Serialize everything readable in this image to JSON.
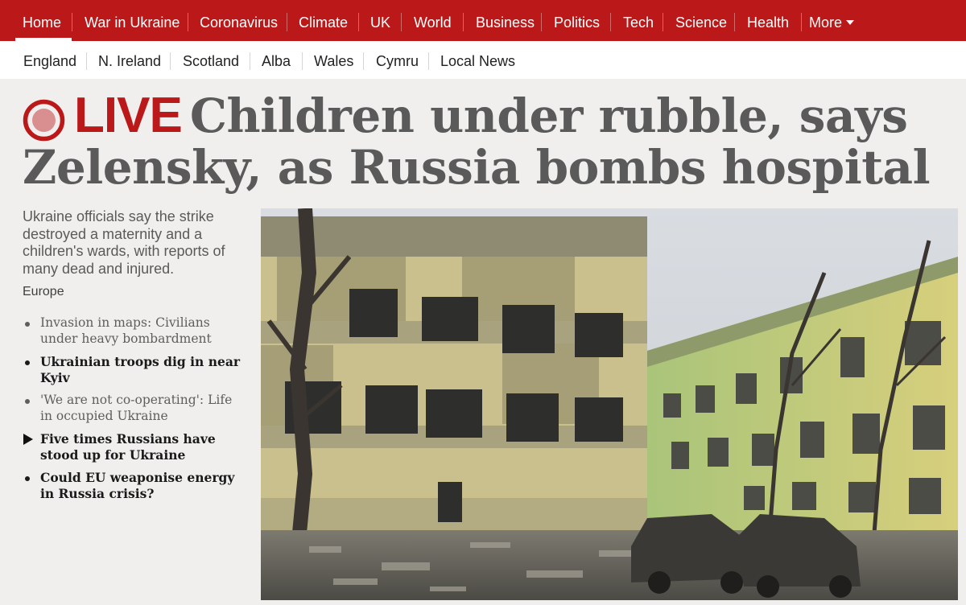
{
  "topnav": {
    "items": [
      {
        "label": "Home",
        "active": true
      },
      {
        "label": "War in Ukraine"
      },
      {
        "label": "Coronavirus"
      },
      {
        "label": "Climate"
      },
      {
        "label": "UK"
      },
      {
        "label": "World"
      },
      {
        "label": "Business"
      },
      {
        "label": "Politics"
      },
      {
        "label": "Tech"
      },
      {
        "label": "Science"
      },
      {
        "label": "Health"
      },
      {
        "label": "More"
      }
    ]
  },
  "subnav": {
    "items": [
      "England",
      "N. Ireland",
      "Scotland",
      "Alba",
      "Wales",
      "Cymru",
      "Local News"
    ]
  },
  "headline": {
    "live_label": "LIVE",
    "text": "Children under rubble, says Zelensky, as Russia bombs hospital"
  },
  "summary": "Ukraine officials say the strike destroyed a maternity and a children's wards, with reports of many dead and injured.",
  "tag": "Europe",
  "related": [
    {
      "text": "Invasion in maps: Civilians under heavy bombardment"
    },
    {
      "text": "Ukrainian troops dig in near Kyiv"
    },
    {
      "text": "'We are not co-operating': Life in occupied Ukraine"
    },
    {
      "text": "Five times Russians have stood up for Ukraine"
    },
    {
      "text": "Could EU weaponise energy in Russia crisis?"
    }
  ],
  "colors": {
    "brand_red": "#bb1919",
    "background": "#f0efed"
  }
}
